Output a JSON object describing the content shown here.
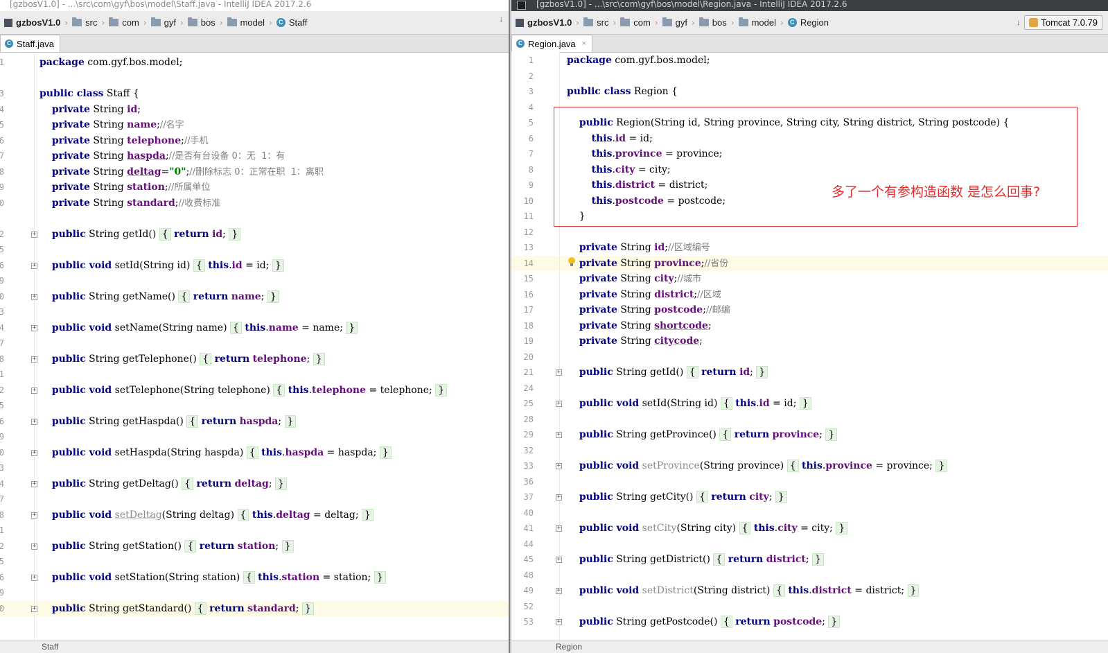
{
  "left_window": {
    "title": "[gzbosV1.0] - ...\\src\\com\\gyf\\bos\\model\\Staff.java - IntelliJ IDEA 2017.2.6",
    "breadcrumbs": [
      "gzbosV1.0",
      "src",
      "com",
      "gyf",
      "bos",
      "model",
      "Staff"
    ],
    "tab_label": "Staff.java",
    "status_label": "Staff",
    "lines": [
      {
        "num": "1",
        "html": "<span class='kw'>package</span> com.gyf.bos.model;"
      },
      {
        "num": "",
        "html": ""
      },
      {
        "num": "3",
        "html": "<span class='kw'>public class</span> Staff {"
      },
      {
        "num": "4",
        "html": "    <span class='kw'>private</span> String <span class='fld'>id</span>;"
      },
      {
        "num": "5",
        "html": "    <span class='kw'>private</span> String <span class='fld'>name</span>;<span class='cm'>//名字</span>"
      },
      {
        "num": "6",
        "html": "    <span class='kw'>private</span> String <span class='fld'>telephone</span>;<span class='cm'>//手机</span>"
      },
      {
        "num": "7",
        "html": "    <span class='kw'>private</span> String <span class='fld uline'>haspda</span>;<span class='cm'>//是否有台设备 0：无  1：有</span>"
      },
      {
        "num": "8",
        "html": "    <span class='kw'>private</span> String <span class='fld uline'>deltag</span>=<span class='str'>\"0\"</span>;<span class='cm'>//删除标志 0：正常在职  1：离职</span>"
      },
      {
        "num": "9",
        "html": "    <span class='kw'>private</span> String <span class='fld'>station</span>;<span class='cm'>//所属单位</span>"
      },
      {
        "num": "0",
        "html": "    <span class='kw'>private</span> String <span class='fld'>standard</span>;<span class='cm'>//收费标准</span>"
      },
      {
        "num": "",
        "html": ""
      },
      {
        "num": "2",
        "html": "    <span class='kw'>public</span> String getId() <span class='brace'>{</span> <span class='kw'>return</span> <span class='fld'>id</span>; <span class='brace'>}</span>",
        "fold": true
      },
      {
        "num": "5",
        "html": ""
      },
      {
        "num": "6",
        "html": "    <span class='kw'>public void</span> setId(String id) <span class='brace'>{</span> <span class='kw'>this</span>.<span class='fld'>id</span> = id; <span class='brace'>}</span>",
        "fold": true
      },
      {
        "num": "9",
        "html": ""
      },
      {
        "num": "0",
        "html": "    <span class='kw'>public</span> String getName() <span class='brace'>{</span> <span class='kw'>return</span> <span class='fld'>name</span>; <span class='brace'>}</span>",
        "fold": true
      },
      {
        "num": "3",
        "html": ""
      },
      {
        "num": "4",
        "html": "    <span class='kw'>public void</span> setName(String name) <span class='brace'>{</span> <span class='kw'>this</span>.<span class='fld'>name</span> = name; <span class='brace'>}</span>",
        "fold": true
      },
      {
        "num": "7",
        "html": ""
      },
      {
        "num": "8",
        "html": "    <span class='kw'>public</span> String getTelephone() <span class='brace'>{</span> <span class='kw'>return</span> <span class='fld'>telephone</span>; <span class='brace'>}</span>",
        "fold": true
      },
      {
        "num": "1",
        "html": ""
      },
      {
        "num": "2",
        "html": "    <span class='kw'>public void</span> setTelephone(String telephone) <span class='brace'>{</span> <span class='kw'>this</span>.<span class='fld'>telephone</span> = telephone; <span class='brace'>}</span>",
        "fold": true
      },
      {
        "num": "5",
        "html": ""
      },
      {
        "num": "6",
        "html": "    <span class='kw'>public</span> String getHaspda() <span class='brace'>{</span> <span class='kw'>return</span> <span class='fld'>haspda</span>; <span class='brace'>}</span>",
        "fold": true
      },
      {
        "num": "9",
        "html": ""
      },
      {
        "num": "0",
        "html": "    <span class='kw'>public void</span> setHaspda(String haspda) <span class='brace'>{</span> <span class='kw'>this</span>.<span class='fld'>haspda</span> = haspda; <span class='brace'>}</span>",
        "fold": true
      },
      {
        "num": "3",
        "html": ""
      },
      {
        "num": "4",
        "html": "    <span class='kw'>public</span> String getDeltag() <span class='brace'>{</span> <span class='kw'>return</span> <span class='fld'>deltag</span>; <span class='brace'>}</span>",
        "fold": true
      },
      {
        "num": "7",
        "html": ""
      },
      {
        "num": "8",
        "html": "    <span class='kw'>public void</span> <span class='grayu'>setDeltag</span>(String deltag) <span class='brace'>{</span> <span class='kw'>this</span>.<span class='fld'>deltag</span> = deltag; <span class='brace'>}</span>",
        "fold": true
      },
      {
        "num": "1",
        "html": ""
      },
      {
        "num": "2",
        "html": "    <span class='kw'>public</span> String getStation() <span class='brace'>{</span> <span class='kw'>return</span> <span class='fld'>station</span>; <span class='brace'>}</span>",
        "fold": true
      },
      {
        "num": "5",
        "html": ""
      },
      {
        "num": "6",
        "html": "    <span class='kw'>public void</span> setStation(String station) <span class='brace'>{</span> <span class='kw'>this</span>.<span class='fld'>station</span> = station; <span class='brace'>}</span>",
        "fold": true
      },
      {
        "num": "9",
        "html": ""
      },
      {
        "num": "0",
        "html": "    <span class='kw'>public</span> String getStandard() <span class='brace'>{</span> <span class='kw'>return</span> <span class='fld'>standard</span>; <span class='brace'>}</span>",
        "fold": true,
        "highlight": true
      }
    ]
  },
  "right_window": {
    "title": "[gzbosV1.0] - ...\\src\\com\\gyf\\bos\\model\\Region.java - IntelliJ IDEA 2017.2.6",
    "breadcrumbs": [
      "gzbosV1.0",
      "src",
      "com",
      "gyf",
      "bos",
      "model",
      "Region"
    ],
    "run_config": "Tomcat 7.0.79",
    "tab_label": "Region.java",
    "status_label": "Region",
    "annotation": "多了一个有参构造函数 是怎么回事?",
    "lines": [
      {
        "num": "1",
        "html": "<span class='kw'>package</span> com.gyf.bos.model;"
      },
      {
        "num": "2",
        "html": ""
      },
      {
        "num": "3",
        "html": "<span class='kw'>public class</span> Region {"
      },
      {
        "num": "4",
        "html": ""
      },
      {
        "num": "5",
        "html": "    <span class='kw'>public</span> Region(String id, String province, String city, String district, String postcode) {"
      },
      {
        "num": "6",
        "html": "        <span class='kw'>this</span>.<span class='fld'>id</span> = id;"
      },
      {
        "num": "7",
        "html": "        <span class='kw'>this</span>.<span class='fld'>province</span> = province;"
      },
      {
        "num": "8",
        "html": "        <span class='kw'>this</span>.<span class='fld'>city</span> = city;"
      },
      {
        "num": "9",
        "html": "        <span class='kw'>this</span>.<span class='fld'>district</span> = district;"
      },
      {
        "num": "10",
        "html": "        <span class='kw'>this</span>.<span class='fld'>postcode</span> = postcode;"
      },
      {
        "num": "11",
        "html": "    }"
      },
      {
        "num": "12",
        "html": ""
      },
      {
        "num": "13",
        "html": "    <span class='kw'>private</span> String <span class='fld'>id</span>;<span class='cm'>//区域编号</span>"
      },
      {
        "num": "14",
        "html": "    <span class='kw'>private</span> String <span class='fld'>province</span>;<span class='cm'>//省份</span>",
        "highlight": true
      },
      {
        "num": "15",
        "html": "    <span class='kw'>private</span> String <span class='fld'>city</span>;<span class='cm'>//城市</span>"
      },
      {
        "num": "16",
        "html": "    <span class='kw'>private</span> String <span class='fld'>district</span>;<span class='cm'>//区域</span>"
      },
      {
        "num": "17",
        "html": "    <span class='kw'>private</span> String <span class='fld'>postcode</span>;<span class='cm'>//邮编</span>"
      },
      {
        "num": "18",
        "html": "    <span class='kw'>private</span> String <span class='fld uline'>shortcode</span>;"
      },
      {
        "num": "19",
        "html": "    <span class='kw'>private</span> String <span class='fld uline'>citycode</span>;"
      },
      {
        "num": "20",
        "html": ""
      },
      {
        "num": "21",
        "html": "    <span class='kw'>public</span> String getId() <span class='brace'>{</span> <span class='kw'>return</span> <span class='fld'>id</span>; <span class='brace'>}</span>",
        "fold": true
      },
      {
        "num": "24",
        "html": ""
      },
      {
        "num": "25",
        "html": "    <span class='kw'>public void</span> setId(String id) <span class='brace'>{</span> <span class='kw'>this</span>.<span class='fld'>id</span> = id; <span class='brace'>}</span>",
        "fold": true
      },
      {
        "num": "28",
        "html": ""
      },
      {
        "num": "29",
        "html": "    <span class='kw'>public</span> String getProvince() <span class='brace'>{</span> <span class='kw'>return</span> <span class='fld'>province</span>; <span class='brace'>}</span>",
        "fold": true
      },
      {
        "num": "32",
        "html": ""
      },
      {
        "num": "33",
        "html": "    <span class='kw'>public void</span> <span class='gray'>setProvince</span>(String province) <span class='brace'>{</span> <span class='kw'>this</span>.<span class='fld'>province</span> = province; <span class='brace'>}</span>",
        "fold": true
      },
      {
        "num": "36",
        "html": ""
      },
      {
        "num": "37",
        "html": "    <span class='kw'>public</span> String getCity() <span class='brace'>{</span> <span class='kw'>return</span> <span class='fld'>city</span>; <span class='brace'>}</span>",
        "fold": true
      },
      {
        "num": "40",
        "html": ""
      },
      {
        "num": "41",
        "html": "    <span class='kw'>public void</span> <span class='gray'>setCity</span>(String city) <span class='brace'>{</span> <span class='kw'>this</span>.<span class='fld'>city</span> = city; <span class='brace'>}</span>",
        "fold": true
      },
      {
        "num": "44",
        "html": ""
      },
      {
        "num": "45",
        "html": "    <span class='kw'>public</span> String getDistrict() <span class='brace'>{</span> <span class='kw'>return</span> <span class='fld'>district</span>; <span class='brace'>}</span>",
        "fold": true
      },
      {
        "num": "48",
        "html": ""
      },
      {
        "num": "49",
        "html": "    <span class='kw'>public void</span> <span class='gray'>setDistrict</span>(String district) <span class='brace'>{</span> <span class='kw'>this</span>.<span class='fld'>district</span> = district; <span class='brace'>}</span>",
        "fold": true
      },
      {
        "num": "52",
        "html": ""
      },
      {
        "num": "53",
        "html": "    <span class='kw'>public</span> String getPostcode() <span class='brace'>{</span> <span class='kw'>return</span> <span class='fld'>postcode</span>; <span class='brace'>}</span>",
        "fold": true
      }
    ]
  },
  "icons": {
    "class_badge": "C",
    "fold_expand": "+",
    "fold_collapse": "-",
    "close_tab": "×",
    "breadcrumb_separator": "›",
    "sort_icon": "↓"
  }
}
